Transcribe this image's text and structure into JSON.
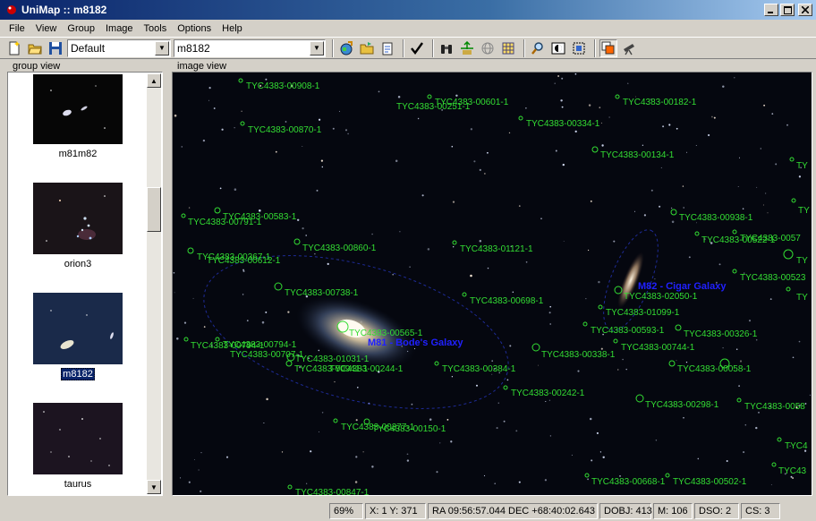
{
  "window": {
    "title": "UniMap :: m8182"
  },
  "menu": [
    "File",
    "View",
    "Group",
    "Image",
    "Tools",
    "Options",
    "Help"
  ],
  "toolbar": {
    "profile_combo": "Default",
    "image_combo": "m8182"
  },
  "group_view": {
    "title": "group view",
    "items": [
      {
        "label": "m81m82",
        "selected": false
      },
      {
        "label": "orion3",
        "selected": false
      },
      {
        "label": "m8182",
        "selected": true
      },
      {
        "label": "taurus",
        "selected": false
      }
    ]
  },
  "image_view": {
    "title": "image view",
    "galaxies": [
      {
        "label": "M81 - Bode's Galaxy"
      },
      {
        "label": "M82 - Cigar Galaxy"
      }
    ],
    "stars": [
      "TYC4383-00908-1",
      "TYC4383-00601-1",
      "TYC4383-00251-1",
      "TYC4383-00182-1",
      "TYC4383-00334-1",
      "TYC4383-00870-1",
      "TYC4383-00134-1",
      "TYC4383-00583-1",
      "TYC4383-00791-1",
      "TYC4383-00938-1",
      "TYC4383-00860-1",
      "TYC4383-01121-1",
      "TYC4383-00522-1",
      "TYC4383-0057",
      "TYC4383-00367-1",
      "TYC4383-00612-1",
      "TYC4383-00523",
      "TYC4383-00738-1",
      "TYC4383-02050-1",
      "TYC4383-00698-1",
      "TYC4383-01099-1",
      "TYC4383-00565-1",
      "TYC4383-00593-1",
      "TYC4383-00326-1",
      "TYC4383-00794-1",
      "TYC4383-00794-1",
      "TYC4383-00744-1",
      "TYC4383-00707-1",
      "TYC4383-00338-1",
      "TYC4383-01031-1",
      "TYC4383-00941-1",
      "TYC4383-00244-1",
      "TYC4383-00384-1",
      "TYC4383-00058-1",
      "TYC4383-00242-1",
      "TYC4383-00298-1",
      "TYC4383-0058",
      "TYC4383-00377-1",
      "TYC4383-00150-1",
      "TYC4",
      "TYC43",
      "TYC4383-00668-1",
      "TYC4383-00502-1",
      "TYC4383-00847-1",
      "TY",
      "TY",
      "TY",
      "TY"
    ]
  },
  "status": {
    "zoom": "69%",
    "xy": "X:   1 Y: 371",
    "radec": "RA  09:56:57.044 DEC +68:40:02.643",
    "dobj": "DOBJ: 413",
    "m": "M: 106",
    "dso": "DSO:  2",
    "cs": "CS:  3"
  },
  "colors": {
    "label_green": "#33dd33",
    "dso_blue": "#2020ff",
    "title_blue": "#0a246a"
  }
}
